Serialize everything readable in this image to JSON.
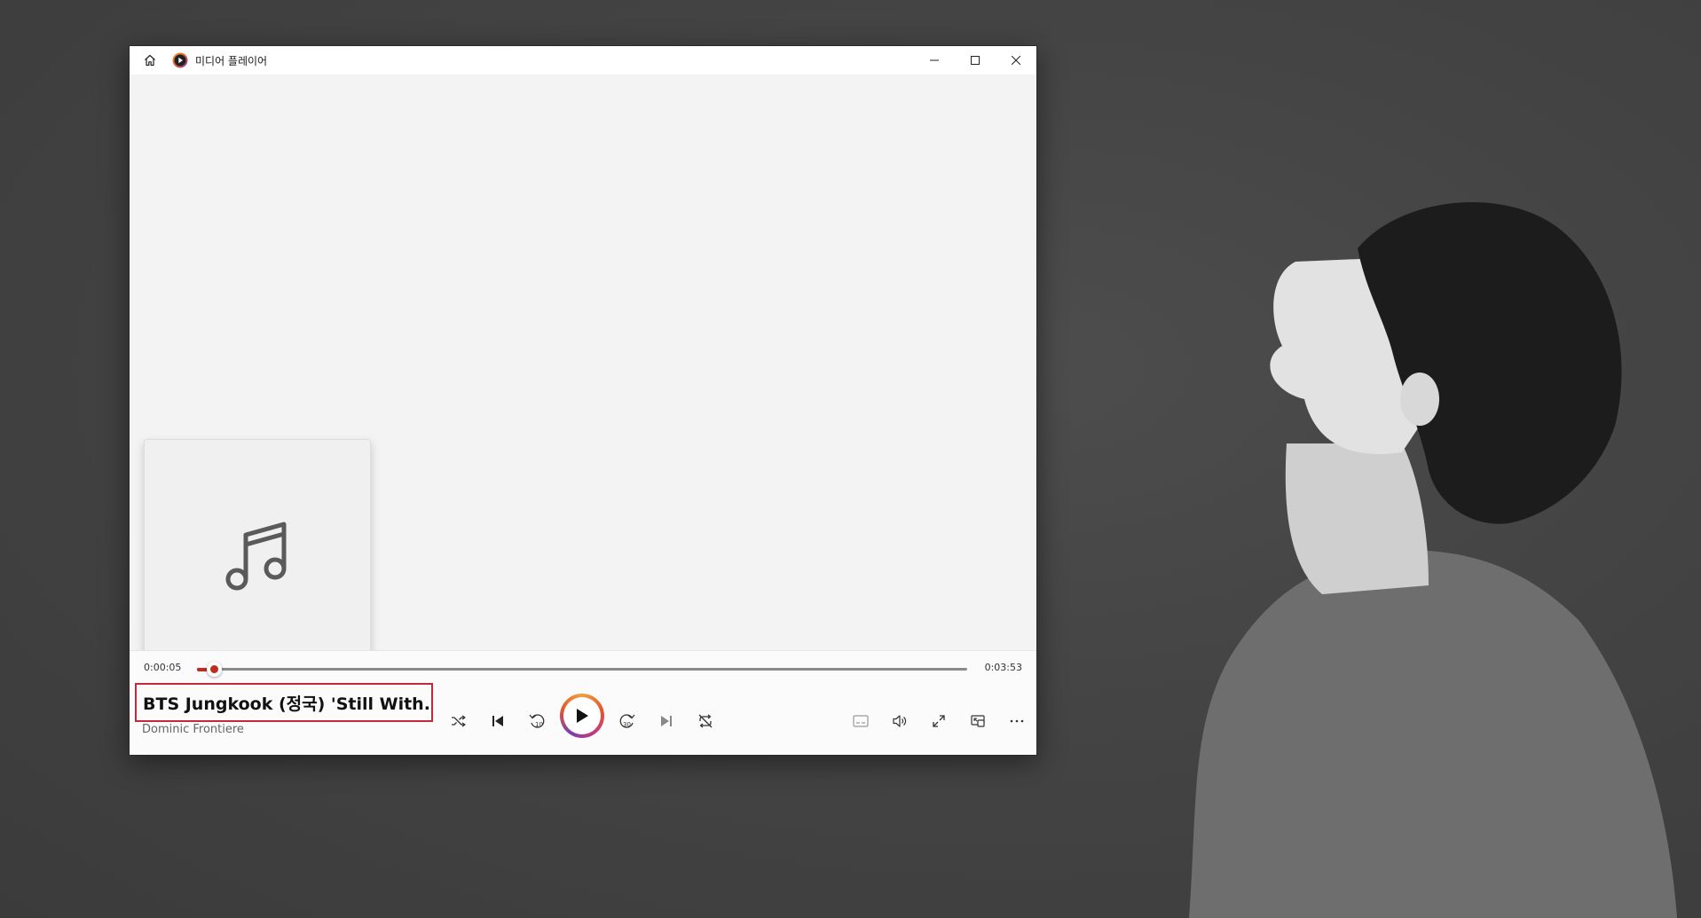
{
  "window": {
    "title": "미디어 플레이어"
  },
  "player": {
    "current_time": "0:00:05",
    "total_time": "0:03:53",
    "progress_fraction": 0.0215,
    "track_title": "BTS Jungkook (정국) 'Still With...",
    "artist": "Dominic Frontiere"
  },
  "icons": {
    "home": "home-icon",
    "app": "media-player-icon",
    "minimize": "minimize-icon",
    "maximize": "maximize-icon",
    "close": "close-icon",
    "album_placeholder": "music-note-icon",
    "shuffle": "shuffle-icon",
    "previous": "previous-icon",
    "rewind": "rewind-10-icon",
    "play": "play-icon",
    "forward": "forward-30-icon",
    "next": "next-icon",
    "repeat": "repeat-off-icon",
    "captions": "captions-icon",
    "volume": "volume-icon",
    "fullscreen": "fullscreen-icon",
    "miniplayer": "miniplayer-icon",
    "more": "more-icon"
  },
  "colors": {
    "accent": "#c42b1c",
    "highlight_box": "#c4283b"
  }
}
